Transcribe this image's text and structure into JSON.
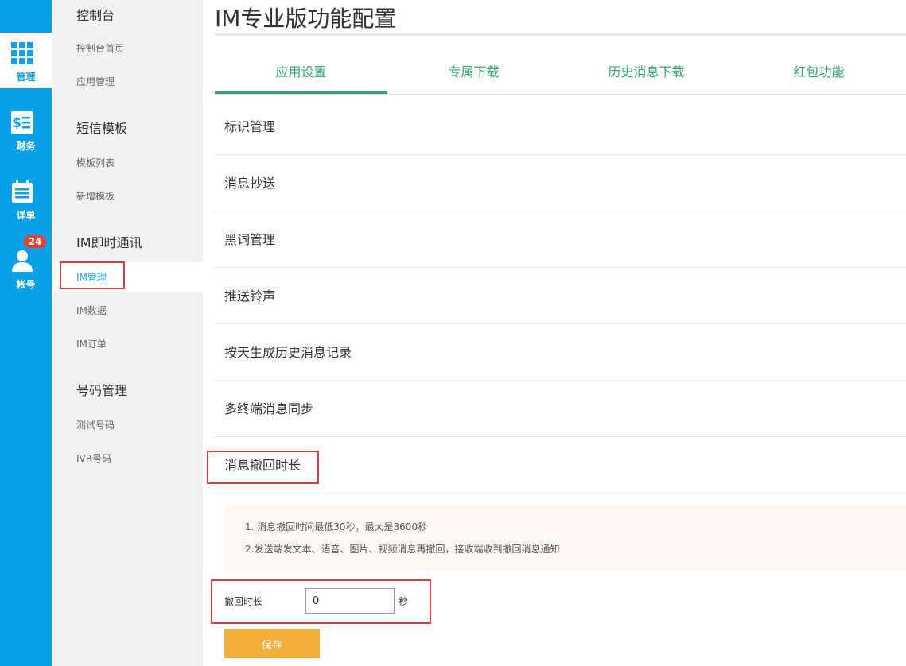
{
  "rail": {
    "items": [
      {
        "label": "管理",
        "icon": "grid-icon"
      },
      {
        "label": "财务",
        "icon": "finance-icon"
      },
      {
        "label": "详单",
        "icon": "calendar-icon"
      },
      {
        "label": "帐号",
        "icon": "user-icon",
        "badge": "24"
      }
    ],
    "active_index": 0,
    "color": "#0aa0e8"
  },
  "submenu": {
    "groups": [
      {
        "title": "控制台",
        "items": [
          "控制台首页",
          "应用管理"
        ]
      },
      {
        "title": "短信模板",
        "items": [
          "模板列表",
          "新增模板"
        ]
      },
      {
        "title": "IM即时通讯",
        "items": [
          "IM管理",
          "IM数据",
          "IM订单"
        ]
      },
      {
        "title": "号码管理",
        "items": [
          "测试号码",
          "IVR号码"
        ]
      }
    ],
    "active_item": "IM管理"
  },
  "page": {
    "title": "IM专业版功能配置"
  },
  "tabs": [
    {
      "label": "应用设置"
    },
    {
      "label": "专属下载"
    },
    {
      "label": "历史消息下载"
    },
    {
      "label": "红包功能"
    }
  ],
  "settings": [
    "标识管理",
    "消息抄送",
    "黑词管理",
    "推送铃声",
    "按天生成历史消息记录",
    "多终端消息同步",
    "消息撤回时长"
  ],
  "tips": [
    "1. 消息撤回时间最低30秒，最大是3600秒",
    "2.发送端发文本、语音、图片、视频消息再撤回，接收端收到撤回消息通知"
  ],
  "form": {
    "label": "撤回时长",
    "value": "0",
    "unit": "秒",
    "save_label": "保存"
  },
  "colors": {
    "accent": "#31a86b",
    "highlight": "#e0393e",
    "save": "#f4ae3c",
    "link": "#1aa0e0"
  }
}
